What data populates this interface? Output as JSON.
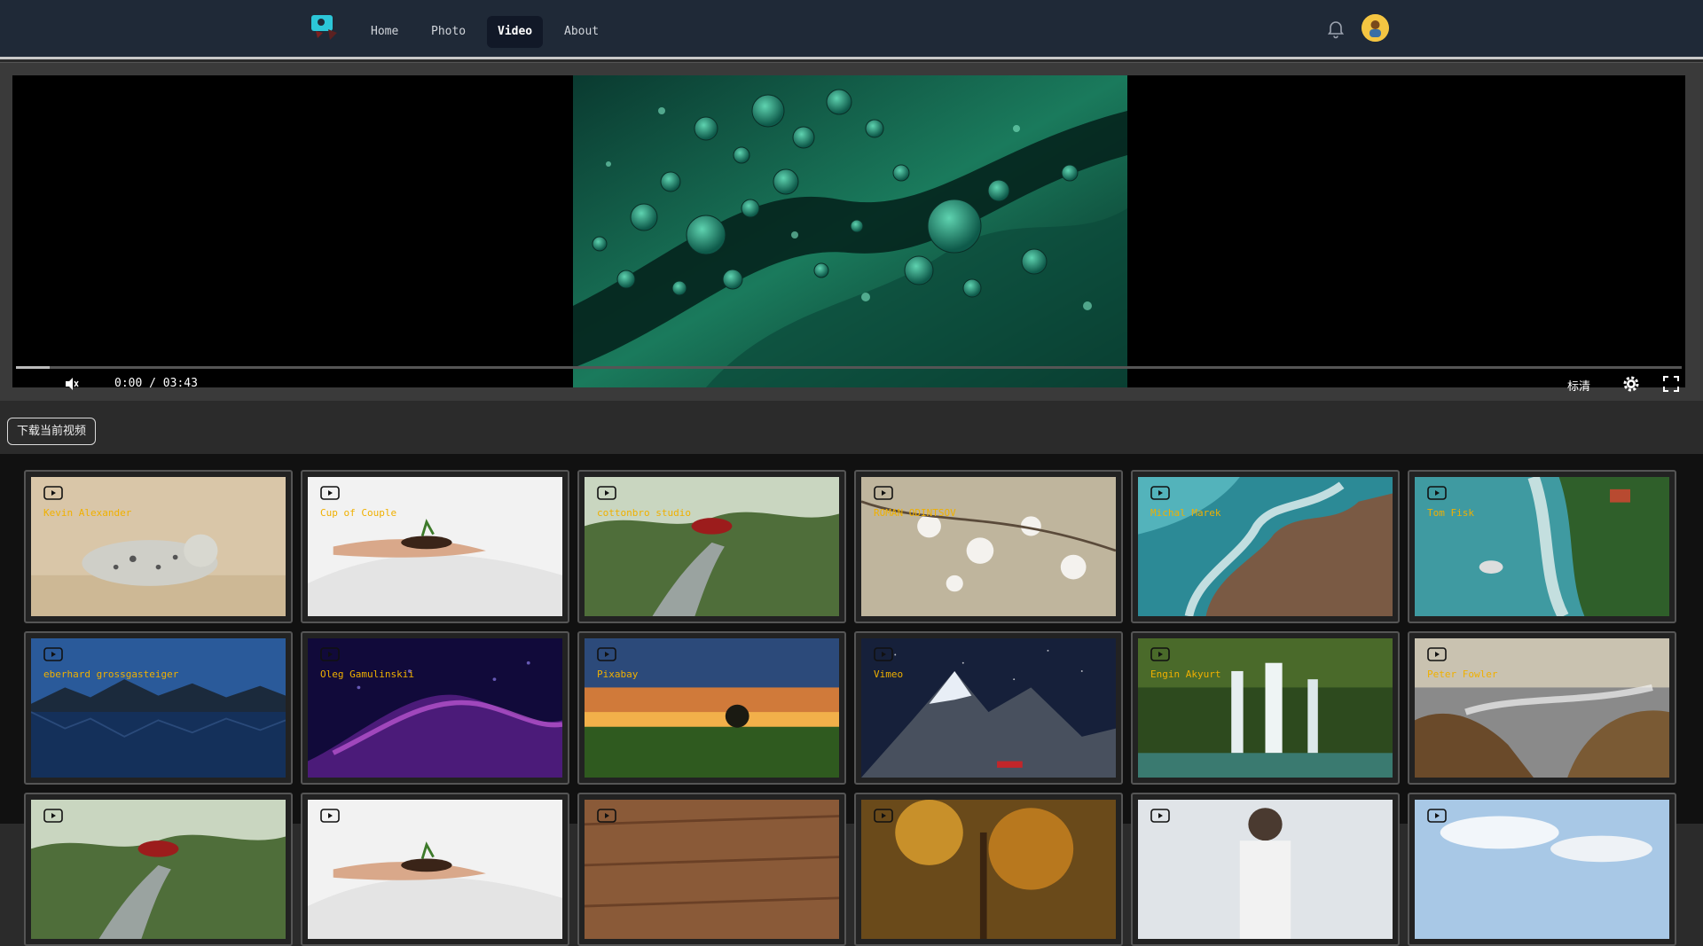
{
  "nav": {
    "items": [
      {
        "label": "Home",
        "active": false
      },
      {
        "label": "Photo",
        "active": false
      },
      {
        "label": "Video",
        "active": true
      },
      {
        "label": "About",
        "active": false
      }
    ],
    "icons": {
      "logo": "camera-logo-icon",
      "bell": "bell-icon",
      "avatar": "user-avatar"
    }
  },
  "player": {
    "time": "0:00 / 03:43",
    "progress": 0.02,
    "quality": "标清",
    "icons": {
      "play": "play-icon",
      "mute": "volume-mute-icon",
      "settings": "gear-icon",
      "fullscreen": "fullscreen-icon"
    }
  },
  "download": {
    "label": "下载当前视频"
  },
  "videos": [
    {
      "author": "Kevin Alexander",
      "theme": "seal"
    },
    {
      "author": "Cup of Couple",
      "theme": "hand"
    },
    {
      "author": "cottonbro studio",
      "theme": "forest"
    },
    {
      "author": "ROMAN ODINTSOV",
      "theme": "blossom"
    },
    {
      "author": "Michal Marek",
      "theme": "coast"
    },
    {
      "author": "Tom Fisk",
      "theme": "beach"
    },
    {
      "author": "eberhard grossgasteiger",
      "theme": "lake"
    },
    {
      "author": "Oleg Gamulinskii",
      "theme": "particles"
    },
    {
      "author": "Pixabay",
      "theme": "sunset"
    },
    {
      "author": "Vimeo",
      "theme": "mountain"
    },
    {
      "author": "Engin Akyurt",
      "theme": "waterfall"
    },
    {
      "author": "Peter Fowler",
      "theme": "rocks"
    },
    {
      "author": "",
      "theme": "forest"
    },
    {
      "author": "",
      "theme": "hand"
    },
    {
      "author": "",
      "theme": "wood"
    },
    {
      "author": "",
      "theme": "autumn"
    },
    {
      "author": "",
      "theme": "person"
    },
    {
      "author": "",
      "theme": "sky"
    }
  ],
  "colors": {
    "nav_bg": "#1f2937",
    "author_text": "#f0b000",
    "active_nav": "#111827"
  }
}
